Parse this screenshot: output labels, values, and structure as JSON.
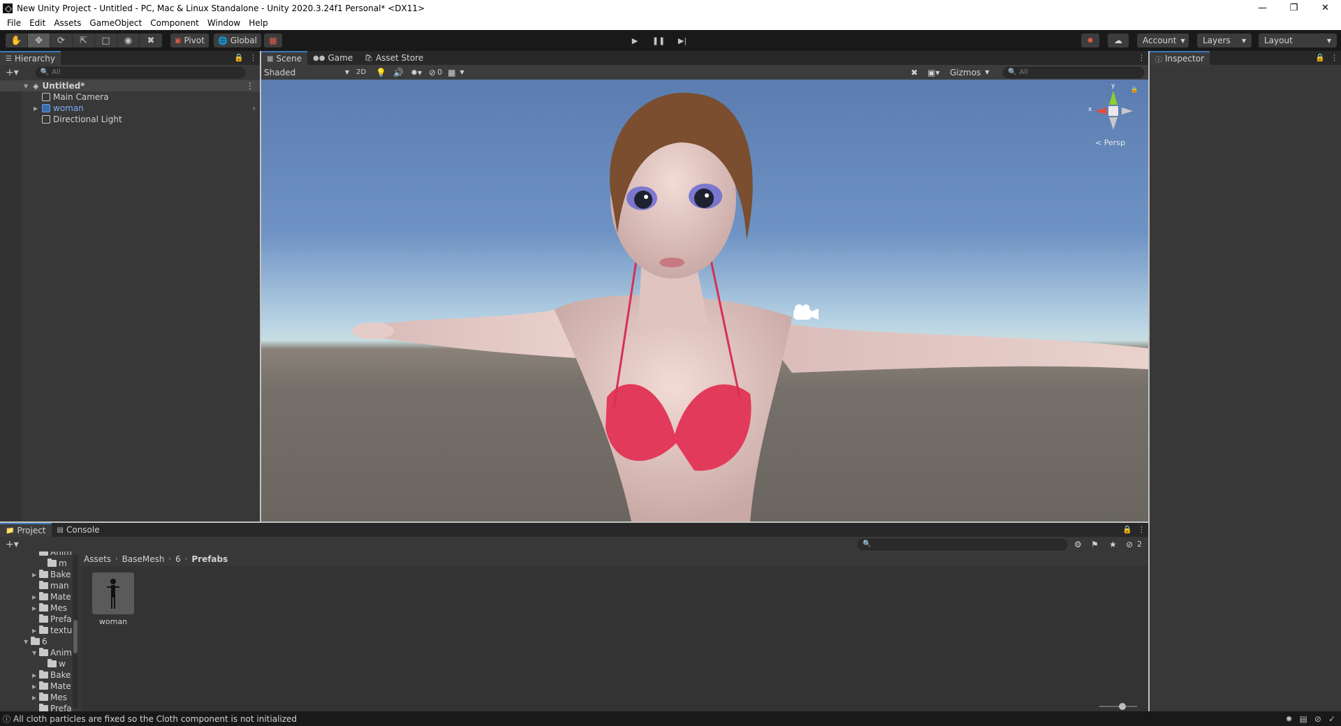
{
  "window": {
    "title": "New Unity Project - Untitled - PC, Mac & Linux Standalone - Unity 2020.3.24f1 Personal* <DX11>"
  },
  "menu": [
    "File",
    "Edit",
    "Assets",
    "GameObject",
    "Component",
    "Window",
    "Help"
  ],
  "toolbar": {
    "pivot_label": "Pivot",
    "global_label": "Global",
    "account_label": "Account",
    "layers_label": "Layers",
    "layout_label": "Layout"
  },
  "hierarchy": {
    "tab_label": "Hierarchy",
    "search_placeholder": "All",
    "scene_name": "Untitled*",
    "items": [
      {
        "label": "Main Camera"
      },
      {
        "label": "woman"
      },
      {
        "label": "Directional Light"
      }
    ]
  },
  "scene": {
    "tabs": [
      {
        "label": "Scene"
      },
      {
        "label": "Game"
      },
      {
        "label": "Asset Store"
      }
    ],
    "shading_mode": "Shaded",
    "mode_2d": "2D",
    "hidden_count": "0",
    "gizmos_label": "Gizmos",
    "search_placeholder": "All",
    "persp_label": "< Persp",
    "axis_x": "x",
    "axis_y": "y"
  },
  "inspector": {
    "tab_label": "Inspector"
  },
  "project": {
    "tabs": [
      {
        "label": "Project"
      },
      {
        "label": "Console"
      }
    ],
    "hidden_count": "2",
    "breadcrumb": [
      "Assets",
      "BaseMesh",
      "6",
      "Prefabs"
    ],
    "tree": [
      {
        "label": "Anim",
        "indent": 3,
        "arrow": ""
      },
      {
        "label": "m",
        "indent": 4,
        "arrow": ""
      },
      {
        "label": "Bake",
        "indent": 3,
        "arrow": "▶"
      },
      {
        "label": "man",
        "indent": 3,
        "arrow": ""
      },
      {
        "label": "Mate",
        "indent": 3,
        "arrow": "▶"
      },
      {
        "label": "Mes",
        "indent": 3,
        "arrow": "▶"
      },
      {
        "label": "Prefa",
        "indent": 3,
        "arrow": ""
      },
      {
        "label": "textu",
        "indent": 3,
        "arrow": "▶"
      },
      {
        "label": "6",
        "indent": 2,
        "arrow": "▼"
      },
      {
        "label": "Anim",
        "indent": 3,
        "arrow": "▼"
      },
      {
        "label": "w",
        "indent": 4,
        "arrow": ""
      },
      {
        "label": "Bake",
        "indent": 3,
        "arrow": "▶"
      },
      {
        "label": "Mate",
        "indent": 3,
        "arrow": "▶"
      },
      {
        "label": "Mes",
        "indent": 3,
        "arrow": "▶"
      },
      {
        "label": "Prefa",
        "indent": 3,
        "arrow": ""
      }
    ],
    "assets": [
      {
        "label": "woman"
      }
    ]
  },
  "status": {
    "message": "All cloth particles are fixed so the Cloth component is not initialized"
  }
}
